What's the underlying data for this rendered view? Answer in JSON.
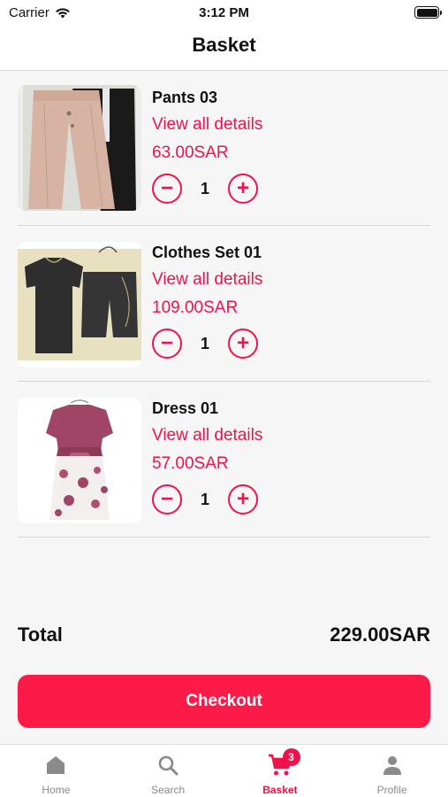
{
  "status_bar": {
    "carrier": "Carrier",
    "time": "3:12 PM"
  },
  "header": {
    "title": "Basket"
  },
  "items": [
    {
      "name": "Pants 03",
      "link": "View all details",
      "price": "63.00SAR",
      "qty": "1",
      "image": "pants"
    },
    {
      "name": "Clothes Set 01",
      "link": "View all details",
      "price": "109.00SAR",
      "qty": "1",
      "image": "clothes-set"
    },
    {
      "name": "Dress 01",
      "link": "View all details",
      "price": "57.00SAR",
      "qty": "1",
      "image": "dress"
    }
  ],
  "qty_controls": {
    "minus": "−",
    "plus": "+"
  },
  "total": {
    "label": "Total",
    "value": "229.00SAR"
  },
  "checkout": {
    "label": "Checkout"
  },
  "tabs": [
    {
      "label": "Home",
      "icon": "home-icon"
    },
    {
      "label": "Search",
      "icon": "search-icon"
    },
    {
      "label": "Basket",
      "icon": "cart-icon",
      "badge": "3",
      "active": true
    },
    {
      "label": "Profile",
      "icon": "profile-icon"
    }
  ],
  "colors": {
    "accent": "#f0124a",
    "button": "#fb1a48",
    "inactive": "#8a8a8a"
  }
}
